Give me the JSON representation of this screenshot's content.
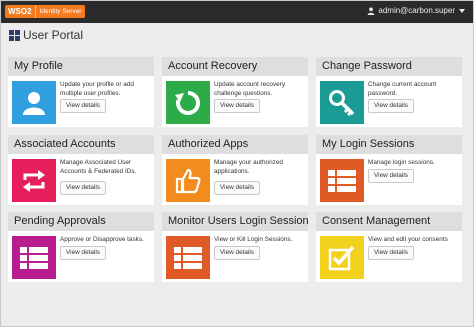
{
  "topbar": {
    "logo_brand": "WSO2",
    "logo_product": "Identity Server",
    "user": "admin@carbon.super"
  },
  "page": {
    "title": "User Portal"
  },
  "colors": {
    "topbar_bg": "#2b2b2b",
    "brand_orange": "#f47b20",
    "card_header_bg": "#dedede",
    "page_bg": "#ececec"
  },
  "cards": [
    {
      "title": "My Profile",
      "description": "Update your profile or add multiple user profiles.",
      "button": "View details",
      "icon": "user-icon",
      "color": "#2f9fe0"
    },
    {
      "title": "Account Recovery",
      "description": "Update account recovery challenge questions.",
      "button": "View details",
      "icon": "refresh-icon",
      "color": "#2eab49"
    },
    {
      "title": "Change Password",
      "description": "Change current account password.",
      "button": "View details",
      "icon": "key-icon",
      "color": "#1b9b96"
    },
    {
      "title": "Associated Accounts",
      "description": "Manage Associated User Accounts & Federated IDs.",
      "button": "View details",
      "icon": "link-accounts-icon",
      "color": "#e61f5c"
    },
    {
      "title": "Authorized Apps",
      "description": "Manage your authorized applications.",
      "button": "View details",
      "icon": "thumbs-up-icon",
      "color": "#f28c1e"
    },
    {
      "title": "My Login Sessions",
      "description": "Manage login sessions.",
      "button": "View details",
      "icon": "list-icon",
      "color": "#e05a25"
    },
    {
      "title": "Pending Approvals",
      "description": "Approve or Disapprove tasks.",
      "button": "View details",
      "icon": "list-icon",
      "color": "#b81c8e"
    },
    {
      "title": "Monitor Users Login Sessions",
      "description": "View or Kill Login Sessions.",
      "button": "View details",
      "icon": "list-icon",
      "color": "#e05a25"
    },
    {
      "title": "Consent Management",
      "description": "View and edit your consents",
      "button": "View details",
      "icon": "checkbox-icon",
      "color": "#f2d11c"
    }
  ]
}
